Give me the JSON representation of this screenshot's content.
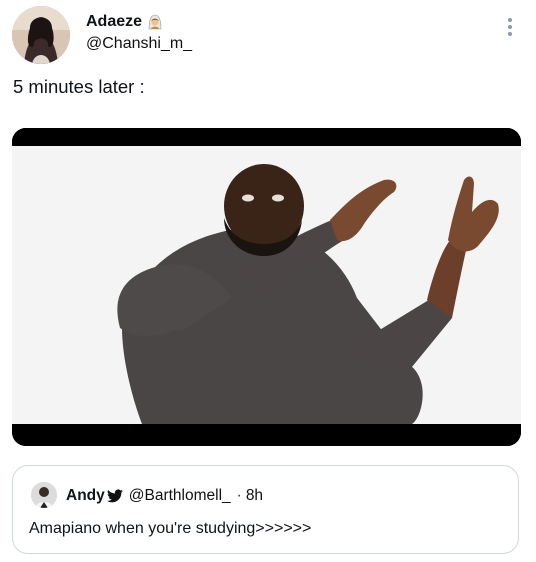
{
  "author": {
    "name": "Adaeze",
    "handle": "@Chanshi_m_",
    "badge_icon": "woman-with-veil-emoji-icon"
  },
  "tweet": {
    "text": "5 minutes later :"
  },
  "media": {
    "icon": "meme-image-man-dancing"
  },
  "more_icon": "vertical-ellipsis-icon",
  "quoted_tweet": {
    "name": "Andy",
    "name_icon": "twitter-bird-icon",
    "handle": "@Barthlomell_",
    "separator": "·",
    "time": "8h",
    "text": "Amapiano when you're studying>>>>>>"
  }
}
